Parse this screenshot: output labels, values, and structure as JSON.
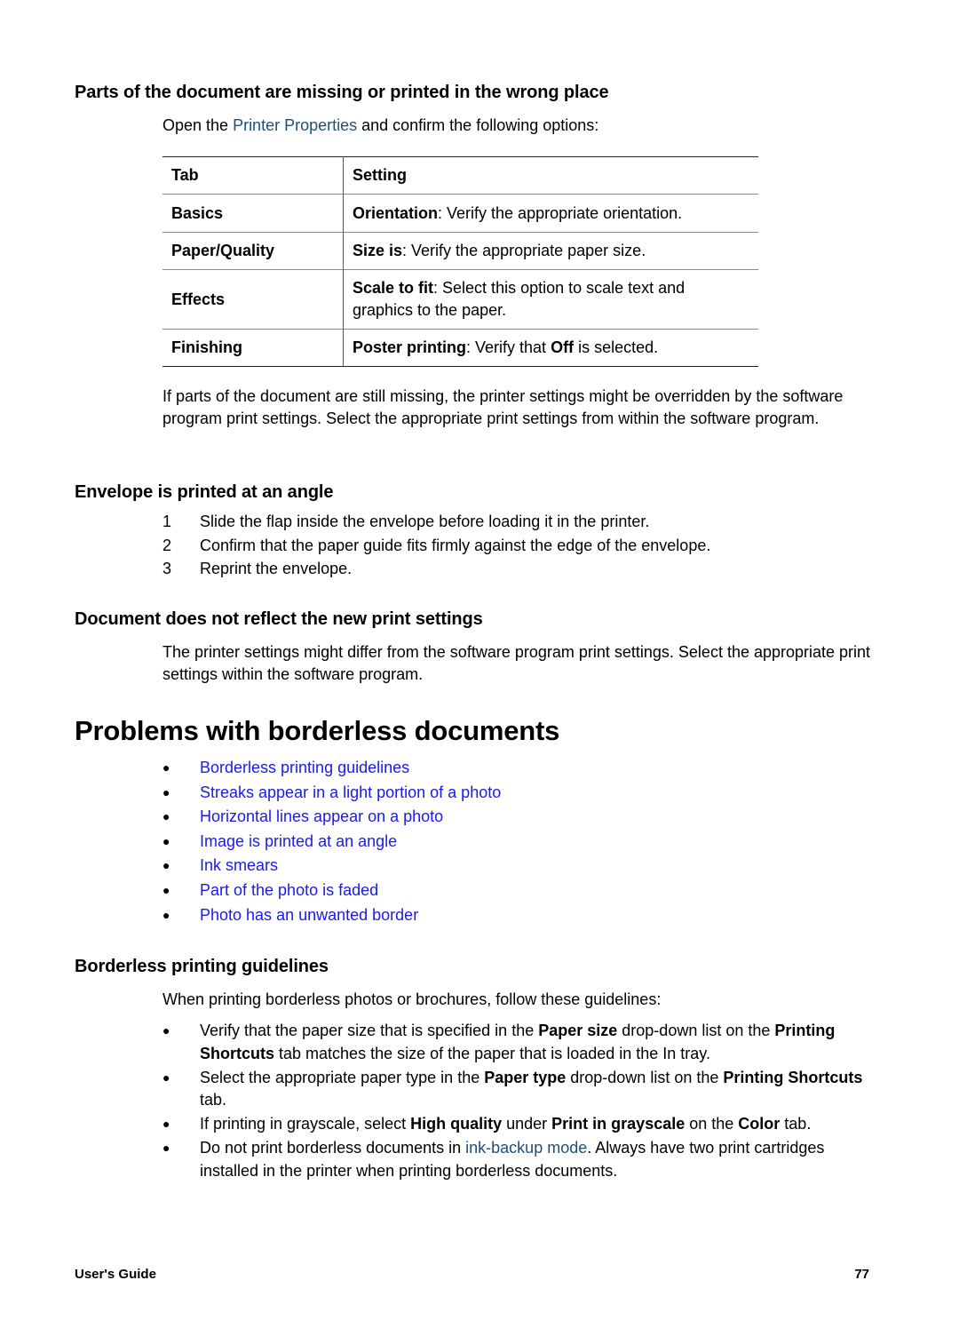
{
  "section1": {
    "heading": "Parts of the document are missing or printed in the wrong place",
    "intro_pre": "Open the ",
    "intro_link": "Printer Properties",
    "intro_post": " and confirm the following options:",
    "table": {
      "headers": [
        "Tab",
        "Setting"
      ],
      "rows": [
        {
          "tab": "Basics",
          "setting_bold": "Orientation",
          "setting_text": ": Verify the appropriate orientation."
        },
        {
          "tab": "Paper/Quality",
          "setting_bold": "Size is",
          "setting_text": ": Verify the appropriate paper size."
        },
        {
          "tab": "Effects",
          "setting_bold": "Scale to fit",
          "setting_text": ": Select this option to scale text and graphics to the paper."
        },
        {
          "tab": "Finishing",
          "setting_bold": "Poster printing",
          "setting_text": ": Verify that ",
          "setting_bold2": "Off",
          "setting_text2": " is selected."
        }
      ]
    },
    "followup": "If parts of the document are still missing, the printer settings might be overridden by the software program print settings. Select the appropriate print settings from within the software program."
  },
  "section2": {
    "heading": "Envelope is printed at an angle",
    "steps": [
      {
        "num": "1",
        "text": "Slide the flap inside the envelope before loading it in the printer."
      },
      {
        "num": "2",
        "text": "Confirm that the paper guide fits firmly against the edge of the envelope."
      },
      {
        "num": "3",
        "text": "Reprint the envelope."
      }
    ]
  },
  "section3": {
    "heading": "Document does not reflect the new print settings",
    "body": "The printer settings might differ from the software program print settings. Select the appropriate print settings within the software program."
  },
  "main_heading": "Problems with borderless documents",
  "topic_links": [
    "Borderless printing guidelines",
    "Streaks appear in a light portion of a photo",
    "Horizontal lines appear on a photo",
    "Image is printed at an angle",
    "Ink smears",
    "Part of the photo is faded",
    "Photo has an unwanted border"
  ],
  "bullet_glyph": "●",
  "section4": {
    "heading": "Borderless printing guidelines",
    "intro": "When printing borderless photos or brochures, follow these guidelines:",
    "g1": {
      "a": "Verify that the paper size that is specified in the ",
      "b1": "Paper size",
      "c": " drop-down list on the ",
      "b2": "Printing Shortcuts",
      "d": " tab matches the size of the paper that is loaded in the In tray."
    },
    "g2": {
      "a": "Select the appropriate paper type in the ",
      "b1": "Paper type",
      "c": " drop-down list on the ",
      "b2": "Printing Shortcuts",
      "d": " tab."
    },
    "g3": {
      "a": "If printing in grayscale, select ",
      "b1": "High quality",
      "c": " under ",
      "b2": "Print in grayscale",
      "d": " on the ",
      "b3": "Color",
      "e": " tab."
    },
    "g4": {
      "a": "Do not print borderless documents in ",
      "link": "ink-backup mode",
      "b": ". Always have two print cartridges installed in the printer when printing borderless documents."
    }
  },
  "footer": {
    "left": "User's Guide",
    "page_number": "77"
  },
  "colors": {
    "inline_link": "#1f4e79",
    "topic_link": "#1a1aee"
  }
}
